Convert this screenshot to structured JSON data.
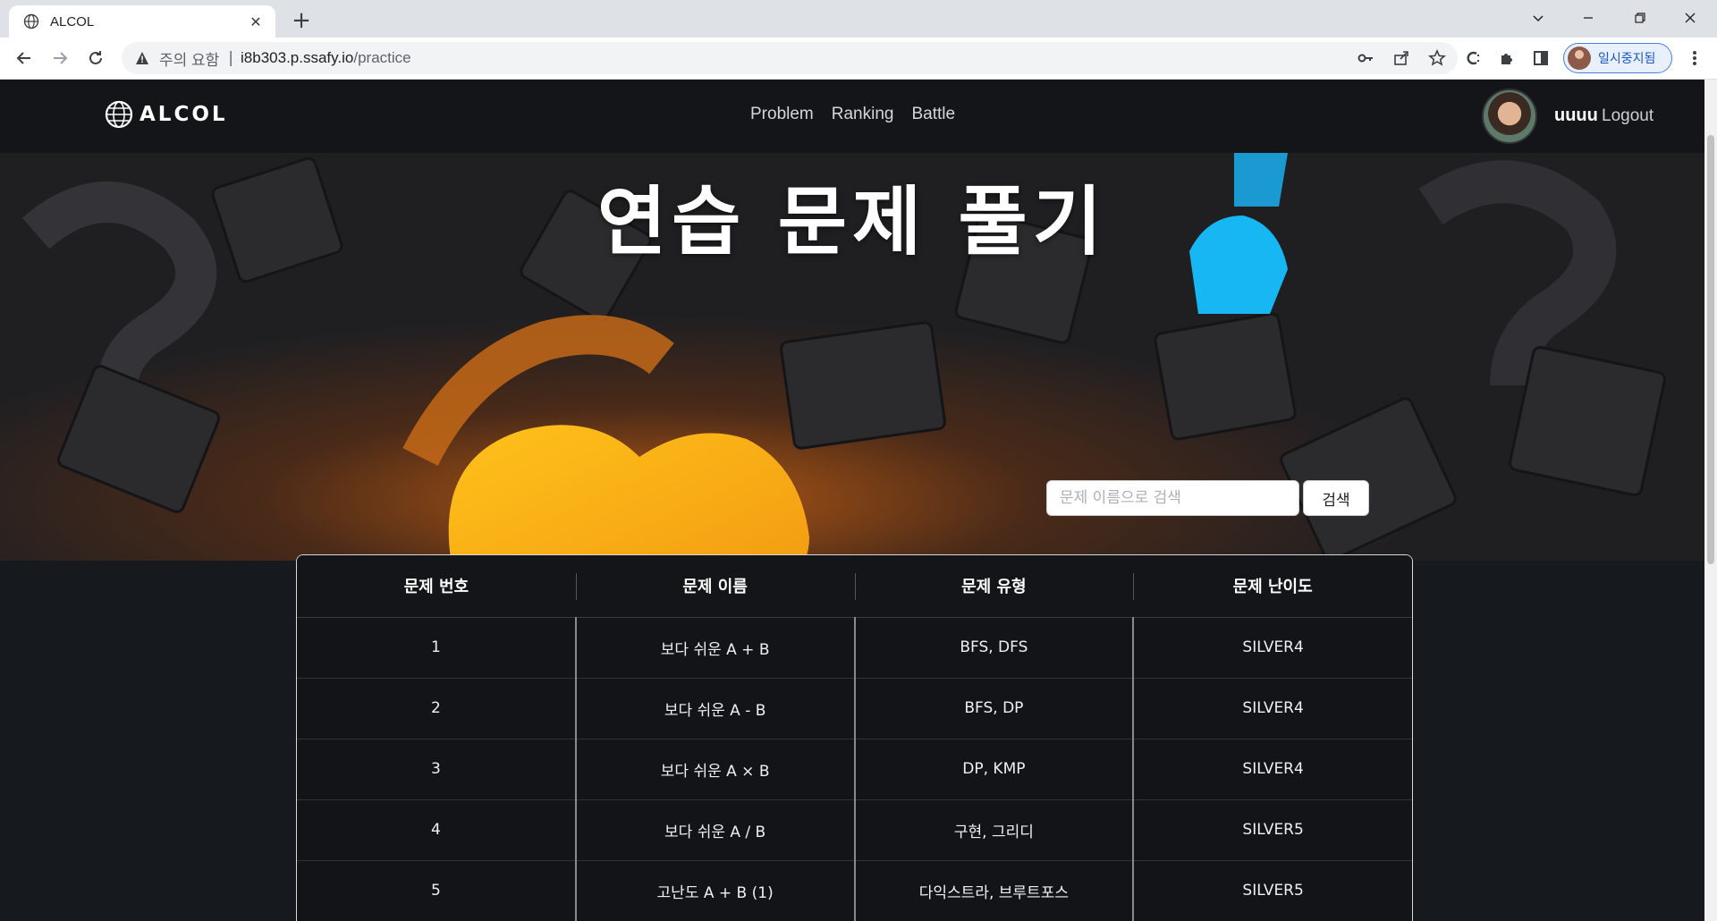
{
  "browser": {
    "tab_title": "ALCOL",
    "new_tab_label": "+",
    "security_warning": "주의 요함",
    "url_host": "i8b303.p.ssafy.io",
    "url_path": "/practice",
    "profile_label": "일시중지됨"
  },
  "navbar": {
    "logo_text": "ALCOL",
    "menu": [
      {
        "label": "Problem"
      },
      {
        "label": "Ranking"
      },
      {
        "label": "Battle"
      }
    ],
    "username": "uuuu",
    "logout_label": "Logout"
  },
  "hero": {
    "title": "연습 문제 풀기",
    "search_placeholder": "문제 이름으로 검색",
    "search_button": "검색"
  },
  "table": {
    "headers": [
      "문제 번호",
      "문제 이름",
      "문제 유형",
      "문제 난이도"
    ],
    "rows": [
      {
        "number": "1",
        "name": "보다 쉬운 A + B",
        "type": "BFS, DFS",
        "level": "SILVER4"
      },
      {
        "number": "2",
        "name": "보다 쉬운 A - B",
        "type": "BFS, DP",
        "level": "SILVER4"
      },
      {
        "number": "3",
        "name": "보다 쉬운 A × B",
        "type": "DP, KMP",
        "level": "SILVER4"
      },
      {
        "number": "4",
        "name": "보다 쉬운 A / B",
        "type": "구현, 그리디",
        "level": "SILVER5"
      },
      {
        "number": "5",
        "name": "고난도 A + B (1)",
        "type": "다익스트라, 브루트포스",
        "level": "SILVER5"
      }
    ]
  },
  "colors": {
    "page_bg": "#16191e",
    "navbar_bg": "#141518",
    "accent_orange": "#f5a623",
    "accent_blue": "#16b7f2"
  }
}
